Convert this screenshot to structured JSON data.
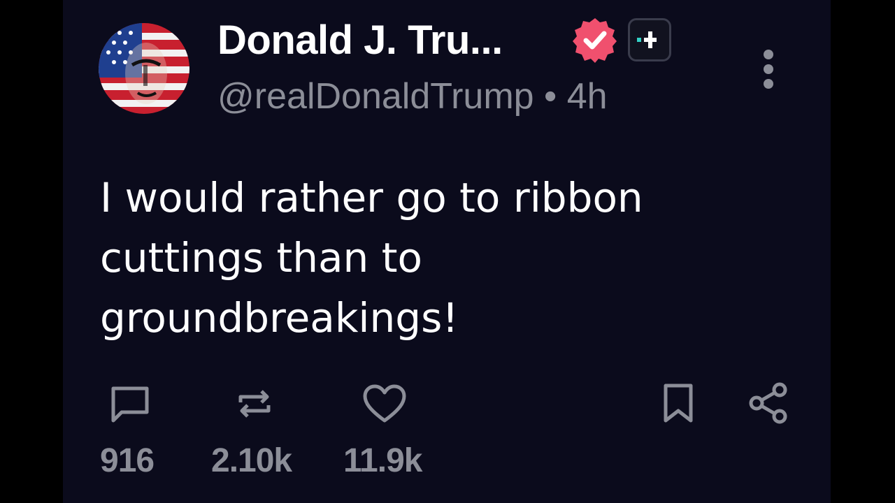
{
  "post": {
    "author_name": "Donald J. Tru...",
    "handle": "@realDonaldTrump",
    "separator": "•",
    "time_ago": "4h",
    "text": "I would rather go to ribbon cuttings than to groundbreakings!"
  },
  "actions": {
    "replies": "916",
    "reposts": "2.10k",
    "likes": "11.9k"
  },
  "colors": {
    "background": "#0b0b1c",
    "text_primary": "#ffffff",
    "text_secondary": "#8c8e98",
    "verified_badge": "#f0506e",
    "plus_badge_accent": "#33d1c6"
  },
  "icons": [
    "avatar",
    "verified-badge-icon",
    "plus-badge-icon",
    "more-options-icon",
    "reply-icon",
    "repost-icon",
    "like-icon",
    "bookmark-icon",
    "share-icon"
  ]
}
